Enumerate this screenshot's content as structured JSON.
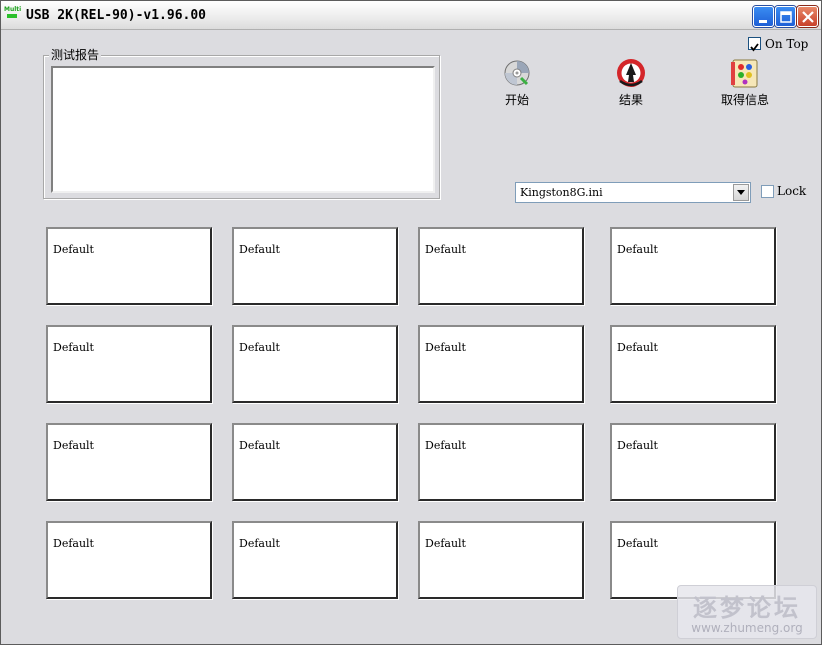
{
  "window": {
    "title": "USB 2K(REL-90)-v1.96.00",
    "icon_label": "Multi"
  },
  "report": {
    "legend": "测试报告",
    "content": ""
  },
  "options": {
    "on_top_label": "On Top",
    "on_top_checked": true,
    "lock_label": "Lock",
    "lock_checked": false
  },
  "tools": [
    {
      "label": "开始",
      "icon": "disc-icon"
    },
    {
      "label": "结果",
      "icon": "result-logo-icon"
    },
    {
      "label": "取得信息",
      "icon": "paint-palette-icon"
    }
  ],
  "profile": {
    "selected": "Kingston8G.ini"
  },
  "ports": [
    "Default",
    "Default",
    "Default",
    "Default",
    "Default",
    "Default",
    "Default",
    "Default",
    "Default",
    "Default",
    "Default",
    "Default",
    "Default",
    "Default",
    "Default",
    "Default"
  ],
  "watermark": {
    "text": "逐梦论坛",
    "url": "www.zhumeng.org"
  }
}
